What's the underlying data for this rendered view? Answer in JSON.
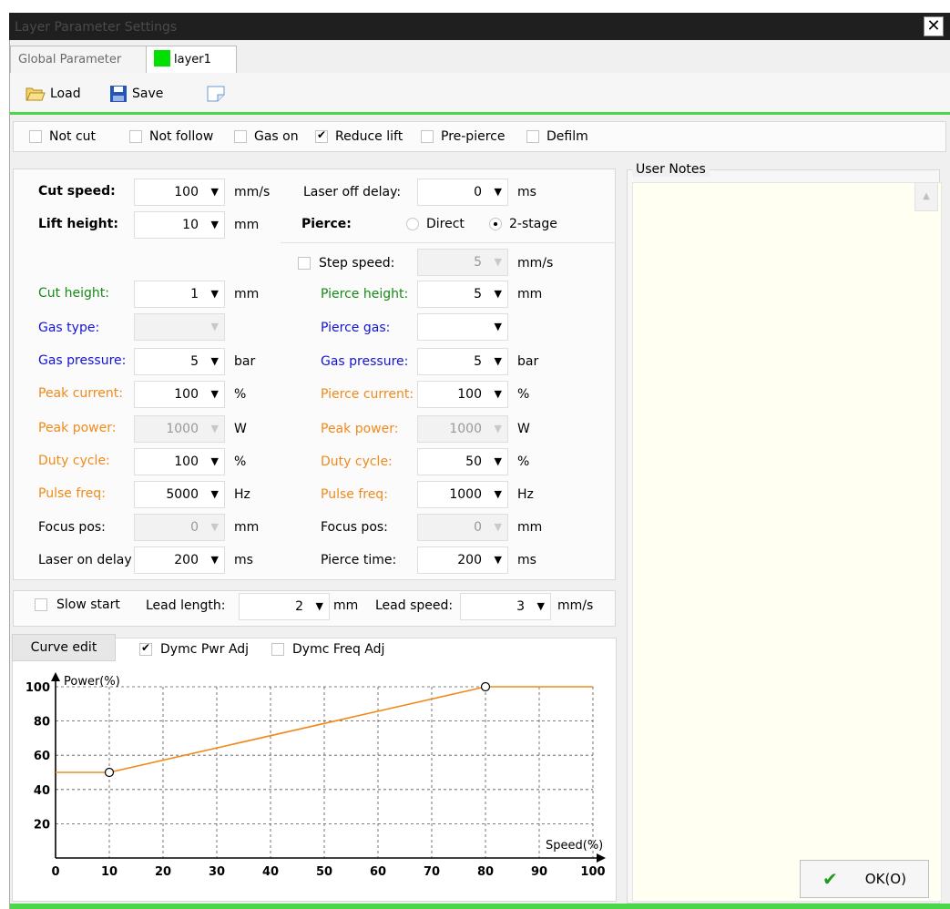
{
  "window": {
    "title": "Layer Parameter Settings",
    "close_glyph": "✕"
  },
  "tabs": [
    {
      "label": "Global Parameter"
    },
    {
      "label": "layer1",
      "swatch_color": "#00e000"
    }
  ],
  "toolbar": {
    "load_label": "Load",
    "save_label": "Save"
  },
  "options": [
    {
      "label": "Not cut",
      "checked": false
    },
    {
      "label": "Not follow",
      "checked": false
    },
    {
      "label": "Gas on",
      "checked": false
    },
    {
      "label": "Reduce lift",
      "checked": true
    },
    {
      "label": "Pre-pierce",
      "checked": false
    },
    {
      "label": "Defilm",
      "checked": false
    }
  ],
  "left": {
    "cut_speed": {
      "label": "Cut speed:",
      "value": "100",
      "unit": "mm/s"
    },
    "lift_height": {
      "label": "Lift height:",
      "value": "10",
      "unit": "mm"
    },
    "cut_height": {
      "label": "Cut height:",
      "value": "1",
      "unit": "mm"
    },
    "gas_type": {
      "label": "Gas type:",
      "value": ""
    },
    "gas_pressure": {
      "label": "Gas pressure:",
      "value": "5",
      "unit": "bar"
    },
    "peak_current": {
      "label": "Peak current:",
      "value": "100",
      "unit": "%"
    },
    "peak_power": {
      "label": "Peak power:",
      "value": "1000",
      "unit": "W"
    },
    "duty_cycle": {
      "label": "Duty cycle:",
      "value": "100",
      "unit": "%"
    },
    "pulse_freq": {
      "label": "Pulse freq:",
      "value": "5000",
      "unit": "Hz"
    },
    "focus_pos": {
      "label": "Focus pos:",
      "value": "0",
      "unit": "mm"
    },
    "laser_on_delay": {
      "label": "Laser on delay",
      "value": "200",
      "unit": "ms"
    }
  },
  "right": {
    "laser_off_delay": {
      "label": "Laser off delay:",
      "value": "0",
      "unit": "ms"
    },
    "pierce": {
      "label": "Pierce:",
      "option_direct": "Direct",
      "option_2stage": "2-stage",
      "selected": "2-stage"
    },
    "step_speed": {
      "label": "Step speed:",
      "value": "5",
      "unit": "mm/s",
      "checked": false
    },
    "pierce_height": {
      "label": "Pierce height:",
      "value": "5",
      "unit": "mm"
    },
    "pierce_gas": {
      "label": "Pierce gas:",
      "value": ""
    },
    "gas_pressure": {
      "label": "Gas pressure:",
      "value": "5",
      "unit": "bar"
    },
    "pierce_current": {
      "label": "Pierce current:",
      "value": "100",
      "unit": "%"
    },
    "peak_power": {
      "label": "Peak power:",
      "value": "1000",
      "unit": "W"
    },
    "duty_cycle": {
      "label": "Duty cycle:",
      "value": "50",
      "unit": "%"
    },
    "pulse_freq": {
      "label": "Pulse freq:",
      "value": "1000",
      "unit": "Hz"
    },
    "focus_pos": {
      "label": "Focus pos:",
      "value": "0",
      "unit": "mm"
    },
    "pierce_time": {
      "label": "Pierce time:",
      "value": "200",
      "unit": "ms"
    }
  },
  "lead": {
    "slow_start": {
      "label": "Slow start",
      "checked": false
    },
    "lead_length": {
      "label": "Lead length:",
      "value": "2",
      "unit": "mm"
    },
    "lead_speed": {
      "label": "Lead speed:",
      "value": "3",
      "unit": "mm/s"
    }
  },
  "curve": {
    "button_label": "Curve edit",
    "dymc_pwr": {
      "label": "Dymc Pwr Adj",
      "checked": true
    },
    "dymc_freq": {
      "label": "Dymc Freq Adj",
      "checked": false
    }
  },
  "notes": {
    "title": "User Notes"
  },
  "ok": {
    "label": "OK(O)"
  },
  "colors": {
    "accent_green": "#4ad84a",
    "curve": "#f08a1c",
    "green_text": "#168a16",
    "blue_text": "#1414d4",
    "orange_text": "#f08a1c"
  },
  "chart_data": {
    "type": "line",
    "ylabel": "Power(%)",
    "xlabel": "Speed(%)",
    "x_ticks": [
      "0",
      "10",
      "20",
      "30",
      "40",
      "50",
      "60",
      "70",
      "80",
      "90",
      "100"
    ],
    "y_ticks": [
      "20",
      "40",
      "60",
      "80",
      "100"
    ],
    "xlim": [
      0,
      100
    ],
    "ylim": [
      0,
      100
    ],
    "grid": true,
    "series": [
      {
        "x": [
          0,
          10,
          80,
          100
        ],
        "y": [
          50,
          50,
          100,
          100
        ]
      }
    ],
    "control_points": [
      {
        "x": 10,
        "y": 50
      },
      {
        "x": 80,
        "y": 100
      }
    ]
  }
}
